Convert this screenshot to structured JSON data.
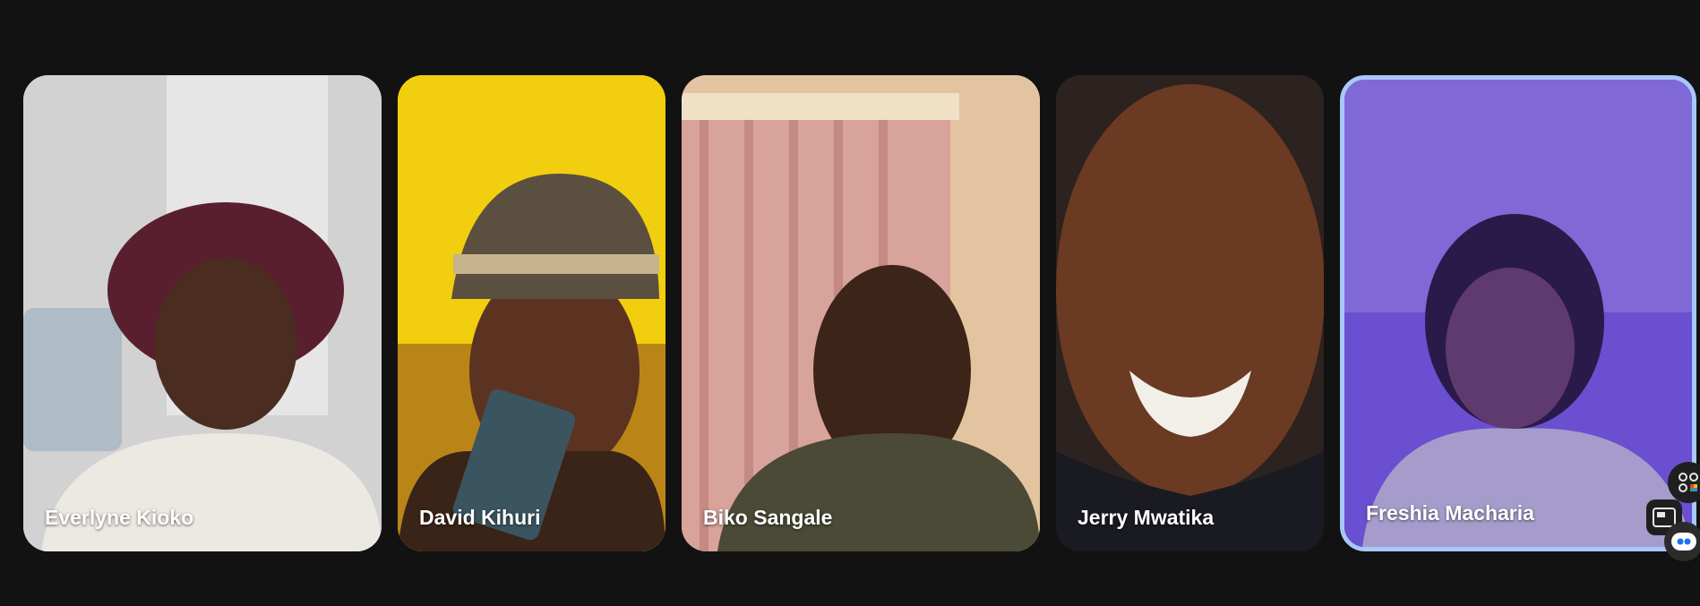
{
  "participants": [
    {
      "name": "Everlyne Kioko"
    },
    {
      "name": "David Kihuri"
    },
    {
      "name": "Biko Sangale"
    },
    {
      "name": "Jerry Mwatika"
    },
    {
      "name": "Freshia Macharia"
    }
  ],
  "active_speaker_border_color": "#a8c7fa",
  "background_color": "#121212",
  "icons": [
    "apps-icon",
    "picture-in-picture-icon",
    "assistant-bot-icon"
  ]
}
